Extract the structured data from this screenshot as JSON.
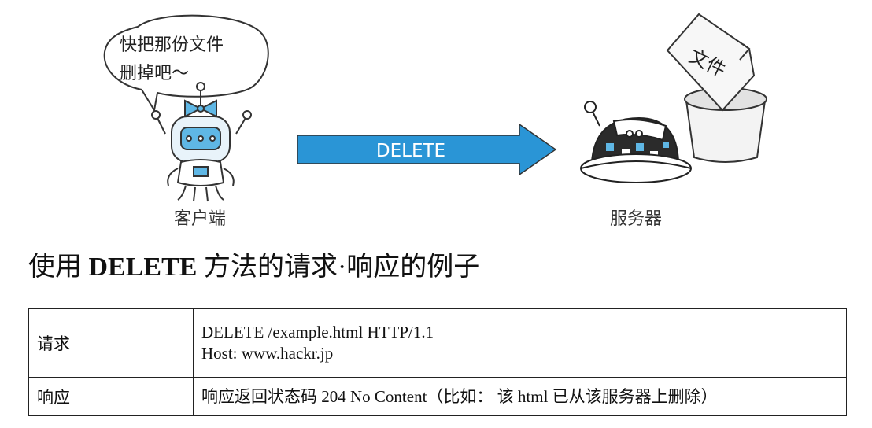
{
  "speech_bubble": {
    "line1": "快把那份文件",
    "line2": "删掉吧～"
  },
  "client_label": "客户端",
  "arrow_label": "DELETE",
  "server_label": "服务器",
  "file_label": "文件",
  "caption": {
    "prefix": "使用",
    "method": "DELETE",
    "suffix": "方法的请求·响应的例子"
  },
  "table": {
    "request": {
      "label": "请求",
      "lines": [
        "DELETE /example.html HTTP/1.1",
        "Host: www.hackr.jp"
      ]
    },
    "response": {
      "label": "响应",
      "text": "响应返回状态码 204 No Content（比如： 该 html 已从该服务器上删除）"
    }
  },
  "colors": {
    "arrow": "#2a95d6",
    "arrow_text": "#ffffff",
    "robot_screen": "#5fb7e5",
    "server_body": "#2b2b2b"
  }
}
